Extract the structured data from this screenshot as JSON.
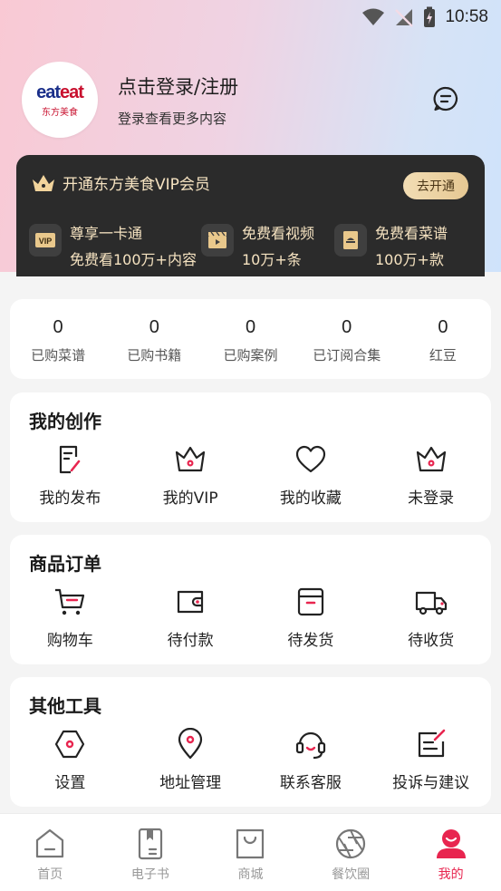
{
  "status_bar": {
    "time": "10:58"
  },
  "profile": {
    "logo_text_a": "eat",
    "logo_text_b": "eat",
    "logo_subtext": "东方美食",
    "login_title": "点击登录/注册",
    "login_subtitle": "登录查看更多内容"
  },
  "vip": {
    "title": "开通东方美食VIP会员",
    "open_button": "去开通",
    "perks": [
      {
        "line1": "尊享一卡通",
        "line2": "免费看100万+内容",
        "icon": "vip-badge-icon"
      },
      {
        "line1": "免费看视频",
        "line2": "10万+条",
        "icon": "video-icon"
      },
      {
        "line1": "免费看菜谱",
        "line2": "100万+款",
        "icon": "recipe-book-icon"
      }
    ],
    "colors": {
      "card": "#2b2b2b",
      "text": "#f6e3c1",
      "button": "#e6c893"
    }
  },
  "stats": [
    {
      "value": "0",
      "label": "已购菜谱"
    },
    {
      "value": "0",
      "label": "已购书籍"
    },
    {
      "value": "0",
      "label": "已购案例"
    },
    {
      "value": "0",
      "label": "已订阅合集"
    },
    {
      "value": "0",
      "label": "红豆"
    }
  ],
  "my_creation": {
    "title": "我的创作",
    "items": [
      {
        "label": "我的发布",
        "icon": "edit-document-icon"
      },
      {
        "label": "我的VIP",
        "icon": "crown-icon"
      },
      {
        "label": "我的收藏",
        "icon": "heart-icon"
      },
      {
        "label": "未登录",
        "icon": "crown-icon"
      }
    ]
  },
  "orders": {
    "title": "商品订单",
    "items": [
      {
        "label": "购物车",
        "icon": "cart-icon"
      },
      {
        "label": "待付款",
        "icon": "wallet-icon"
      },
      {
        "label": "待发货",
        "icon": "box-icon"
      },
      {
        "label": "待收货",
        "icon": "truck-icon"
      }
    ]
  },
  "tools": {
    "title": "其他工具",
    "items": [
      {
        "label": "设置",
        "icon": "settings-icon"
      },
      {
        "label": "地址管理",
        "icon": "location-pin-icon"
      },
      {
        "label": "联系客服",
        "icon": "headset-icon"
      },
      {
        "label": "投诉与建议",
        "icon": "feedback-icon"
      }
    ]
  },
  "tabbar": {
    "tabs": [
      {
        "label": "首页",
        "icon": "home-icon"
      },
      {
        "label": "电子书",
        "icon": "ebook-icon"
      },
      {
        "label": "商城",
        "icon": "shopping-bag-icon"
      },
      {
        "label": "餐饮圈",
        "icon": "aperture-icon"
      },
      {
        "label": "我的",
        "icon": "profile-icon"
      }
    ],
    "active": "我的",
    "active_color": "#e8254f",
    "inactive_color": "#999999"
  },
  "accent_color": "#e8254f"
}
